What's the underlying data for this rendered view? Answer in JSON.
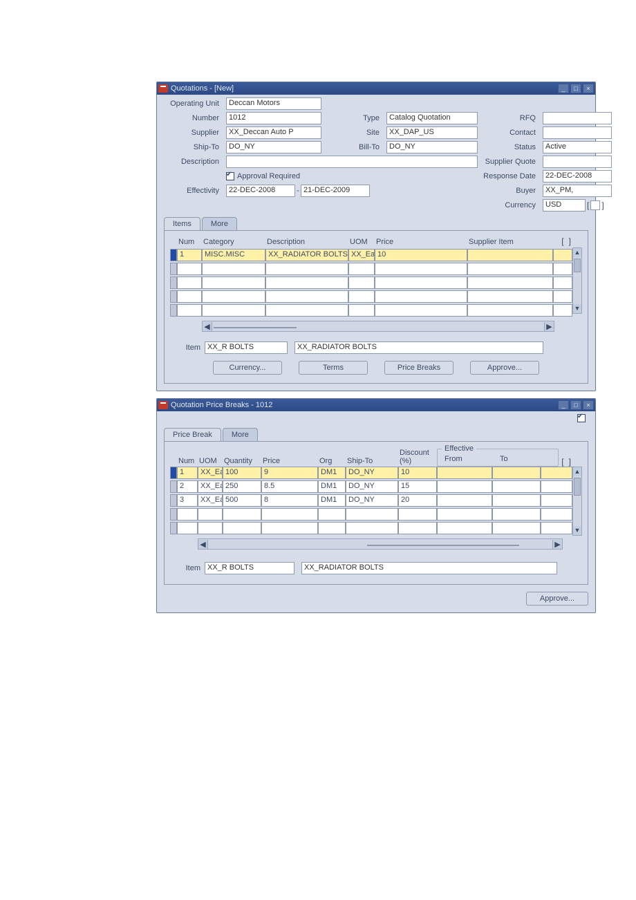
{
  "win1": {
    "title": "Quotations - [New]",
    "labels": {
      "operating_unit": "Operating Unit",
      "number": "Number",
      "supplier": "Supplier",
      "ship_to": "Ship-To",
      "description": "Description",
      "effectivity": "Effectivity",
      "type": "Type",
      "site": "Site",
      "bill_to": "Bill-To",
      "rfq": "RFQ",
      "contact": "Contact",
      "status": "Status",
      "supplier_quote": "Supplier Quote",
      "response_date": "Response Date",
      "buyer": "Buyer",
      "currency": "Currency",
      "approval_required": "Approval Required"
    },
    "values": {
      "operating_unit": "Deccan Motors",
      "number": "1012",
      "supplier": "XX_Deccan Auto P",
      "ship_to": "DO_NY",
      "description": "",
      "eff_from": "22-DEC-2008",
      "eff_to": "21-DEC-2009",
      "type": "Catalog Quotation",
      "site": "XX_DAP_US",
      "bill_to": "DO_NY",
      "rfq": "",
      "contact": "",
      "status": "Active",
      "supplier_quote": "",
      "response_date": "22-DEC-2008",
      "buyer": "XX_PM,",
      "currency": "USD",
      "approval_required_checked": true
    },
    "tabs": {
      "items": "Items",
      "more": "More"
    },
    "items_grid": {
      "headers": {
        "num": "Num",
        "category": "Category",
        "description": "Description",
        "uom": "UOM",
        "price": "Price",
        "supplier_item": "Supplier Item"
      },
      "rows": [
        {
          "num": "1",
          "category": "MISC.MISC",
          "description": "XX_RADIATOR BOLTS",
          "uom": "XX_Ea",
          "price": "10",
          "supplier_item": ""
        }
      ],
      "empty_rows": 4
    },
    "item_footer": {
      "label": "Item",
      "code": "XX_R BOLTS",
      "desc": "XX_RADIATOR BOLTS"
    },
    "buttons": {
      "currency": "Currency...",
      "terms": "Terms",
      "price_breaks": "Price Breaks",
      "approve": "Approve..."
    }
  },
  "win2": {
    "title": "Quotation Price Breaks - 1012",
    "show_check": true,
    "tabs": {
      "price_break": "Price Break",
      "more": "More"
    },
    "grid": {
      "headers": {
        "num": "Num",
        "uom": "UOM",
        "quantity": "Quantity",
        "price": "Price",
        "org": "Org",
        "ship_to": "Ship-To",
        "discount": "Discount\n(%)",
        "effective": "Effective",
        "from": "From",
        "to": "To"
      },
      "rows": [
        {
          "num": "1",
          "uom": "XX_Ea",
          "quantity": "100",
          "price": "9",
          "org": "DM1",
          "ship_to": "DO_NY",
          "discount": "10",
          "from": "",
          "to": ""
        },
        {
          "num": "2",
          "uom": "XX_Ea",
          "quantity": "250",
          "price": "8.5",
          "org": "DM1",
          "ship_to": "DO_NY",
          "discount": "15",
          "from": "",
          "to": ""
        },
        {
          "num": "3",
          "uom": "XX_Ea",
          "quantity": "500",
          "price": "8",
          "org": "DM1",
          "ship_to": "DO_NY",
          "discount": "20",
          "from": "",
          "to": ""
        }
      ],
      "empty_rows": 2
    },
    "item_footer": {
      "label": "Item",
      "code": "XX_R BOLTS",
      "desc": "XX_RADIATOR BOLTS"
    },
    "buttons": {
      "approve": "Approve..."
    }
  }
}
